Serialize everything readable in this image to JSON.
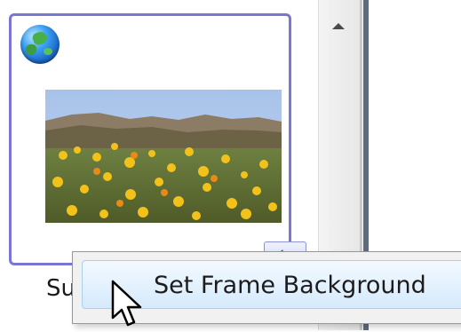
{
  "file_item": {
    "label": "Su"
  },
  "context_menu": {
    "items": [
      {
        "label": "Set Frame Background"
      }
    ]
  },
  "icons": {
    "badge": "globe-icon",
    "action": "green-arrow-icon",
    "scroll": "scroll-up-icon",
    "pointer": "mouse-cursor-icon"
  },
  "colors": {
    "selection_border": "#7a76d6",
    "menu_highlight": "#d5eafc",
    "menu_background": "#f1f1f1",
    "arrow_green": "#2e9b2e"
  }
}
